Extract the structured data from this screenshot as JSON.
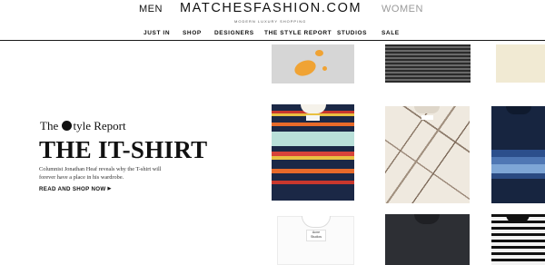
{
  "header": {
    "men_label": "MEN",
    "women_label": "WOMEN",
    "logo": "MATCHESFASHION.COM",
    "tagline": "MODERN LUXURY SHOPPING",
    "nav": [
      {
        "label": "JUST IN"
      },
      {
        "label": "SHOP"
      },
      {
        "label": "DESIGNERS"
      },
      {
        "label": "THE STYLE REPORT"
      },
      {
        "label": "STUDIOS"
      },
      {
        "label": "SALE"
      }
    ]
  },
  "hero": {
    "eyebrow_pre": "The",
    "eyebrow_post": "tyle Report",
    "title": "THE IT-SHIRT",
    "body": "Columnist Jonathan Heaf reveals why the T-shirt will forever have a place in his wardrobe.",
    "cta": "READ AND SHOP NOW",
    "cta_icon": "chevron-right-icon"
  },
  "shirts": {
    "tag_text": "Acne Studios"
  },
  "colors": {
    "header_rule": "#1a1a1a",
    "women_inactive": "#9a9a9a",
    "accent_orange": "#f0a334"
  }
}
